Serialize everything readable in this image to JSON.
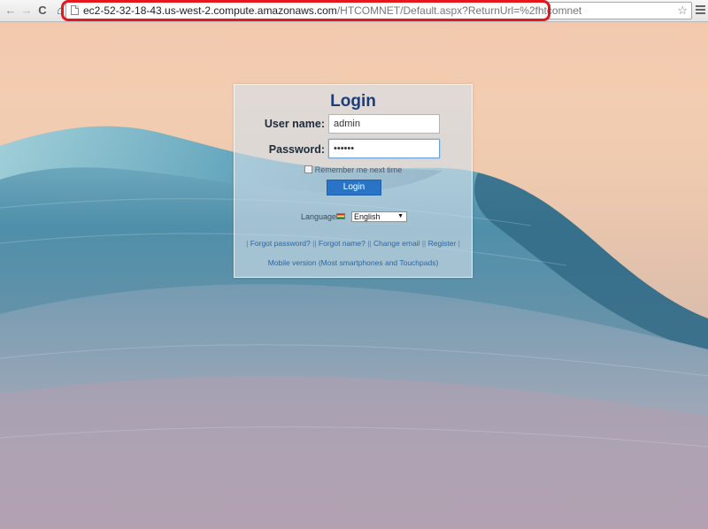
{
  "browser": {
    "url_host": "ec2-52-32-18-43.us-west-2.compute.amazonaws.com",
    "url_rest": "/HTCOMNET/Default.aspx?ReturnUrl=%2fhtcomnet",
    "back_glyph": "←",
    "forward_glyph": "→",
    "reload_glyph": "C",
    "home_glyph": "⌂",
    "star_glyph": "☆",
    "highlight_color": "#e8161d"
  },
  "login": {
    "title": "Login",
    "username_label": "User name:",
    "username_value": "admin",
    "password_label": "Password:",
    "password_value": "••••••",
    "remember_label": "Remember me next time",
    "button_label": "Login",
    "language_label": "Language",
    "language_value": "English",
    "dropdown_glyph": "▼"
  },
  "links": {
    "bar_left": "|",
    "forgot_password": "Forgot password?",
    "forgot_name": "Forgot name?",
    "change_email": "Change email",
    "register": "Register",
    "separator": "||",
    "bar_right": "|",
    "mobile": "Mobile version (Most smartphones and Touchpads)"
  },
  "colors": {
    "title": "#1b3d78",
    "button": "#2a74c8",
    "link": "#2b66a4"
  }
}
